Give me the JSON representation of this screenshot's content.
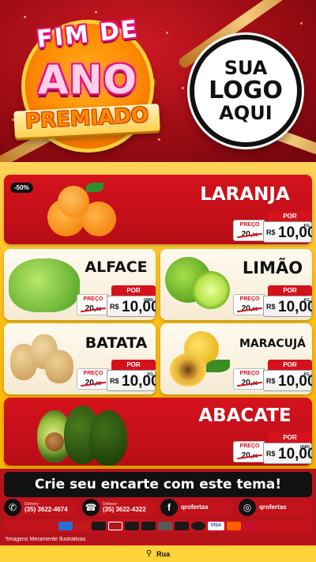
{
  "header": {
    "title_top": "FIM DE",
    "title_mid": "ANO",
    "title_bottom": "PREMIADO",
    "logo_line1": "SUA",
    "logo_line2": "LOGO",
    "logo_line3": "AQUI"
  },
  "products": [
    {
      "name": "LARANJA",
      "badge": "-50%",
      "price_label": "PREÇO",
      "por_label": "POR",
      "old_price": "20,",
      "old_cents": "00",
      "currency": "R$",
      "price": "10,00",
      "unit": "KG"
    },
    {
      "name": "ALFACE",
      "price_label": "PREÇO",
      "por_label": "POR",
      "old_price": "20,",
      "old_cents": "00",
      "currency": "R$",
      "price": "10,00",
      "unit": "UNID"
    },
    {
      "name": "LIMÃO",
      "price_label": "PREÇO",
      "por_label": "POR",
      "old_price": "20,",
      "old_cents": "00",
      "currency": "R$",
      "price": "10,00",
      "unit": "KG"
    },
    {
      "name": "BATATA",
      "price_label": "PREÇO",
      "por_label": "POR",
      "old_price": "20,",
      "old_cents": "00",
      "currency": "R$",
      "price": "10,00",
      "unit": "KG"
    },
    {
      "name": "MARACUJÁ",
      "price_label": "PREÇO",
      "por_label": "POR",
      "old_price": "20,",
      "old_cents": "00",
      "currency": "R$",
      "price": "10,00",
      "unit": "KG"
    },
    {
      "name": "ABACATE",
      "price_label": "PREÇO",
      "por_label": "POR",
      "old_price": "20,",
      "old_cents": "00",
      "currency": "R$",
      "price": "10,00",
      "unit": "UNID"
    }
  ],
  "cta": "Crie seu encarte com este tema!",
  "contacts": [
    {
      "icon": "whatsapp-icon",
      "label": "Delivery",
      "value": "(35) 3622-4674"
    },
    {
      "icon": "phone-icon",
      "label": "Delivery",
      "value": "(35) 3622-4322"
    },
    {
      "icon": "facebook-icon",
      "label": "",
      "value": "qrofertas"
    },
    {
      "icon": "instagram-icon",
      "label": "",
      "value": "qrofertas"
    }
  ],
  "payments": [
    {
      "name": "amex-icon",
      "text": "",
      "color": "#2a6fd6"
    },
    {
      "name": "card-red-icon",
      "text": "",
      "color": "#c21a1a"
    },
    {
      "name": "elo-icon",
      "text": "",
      "color": "#1a1a1a"
    },
    {
      "name": "hipercard-icon",
      "text": "",
      "color": "#b3161c"
    },
    {
      "name": "card-icon",
      "text": "",
      "color": "#1a1a1a"
    },
    {
      "name": "pix-icon",
      "text": "",
      "color": "#1a1a1a"
    },
    {
      "name": "credit-card-icon",
      "text": "",
      "color": "#5a5a5a"
    },
    {
      "name": "card-dark-icon",
      "text": "",
      "color": "#1a1a1a"
    },
    {
      "name": "coin-icon",
      "text": "",
      "color": "#1a1a1a"
    },
    {
      "name": "visa-icon",
      "text": "VISA",
      "color": "#1a3f9c"
    },
    {
      "name": "mastercard-icon",
      "text": "",
      "color": "#ff5f00"
    },
    {
      "name": "redshop-icon",
      "text": "",
      "color": "#c8102e"
    }
  ],
  "disclaimer": "*Imagens Meramente Ilustrativas",
  "address": "Rua",
  "colors": {
    "brand_red": "#d5121c",
    "gold": "#ffc21c"
  }
}
